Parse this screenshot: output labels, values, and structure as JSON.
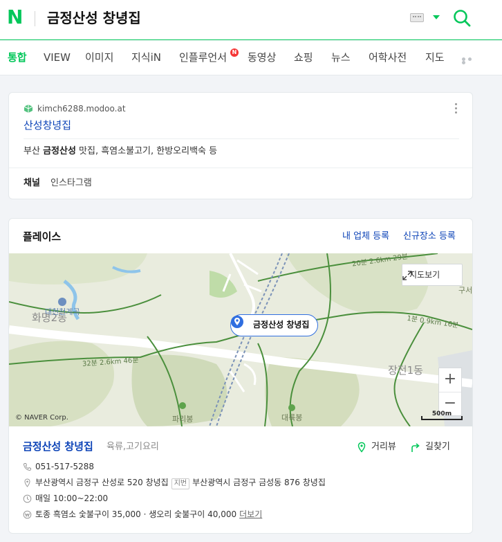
{
  "header": {
    "logo": "N",
    "query": "금정산성 창녕집"
  },
  "tabs": [
    {
      "label": "통합",
      "active": true
    },
    {
      "label": "VIEW"
    },
    {
      "label": "이미지"
    },
    {
      "label": "지식iN"
    },
    {
      "label": "인플루언서",
      "badge": "N"
    },
    {
      "label": "동영상"
    },
    {
      "label": "쇼핑"
    },
    {
      "label": "뉴스"
    },
    {
      "label": "어학사전"
    },
    {
      "label": "지도"
    }
  ],
  "site_result": {
    "url": "kimch6288.modoo.at",
    "title_prefix": "산성",
    "title_highlight": "창녕집",
    "desc_prefix": "부산 ",
    "desc_highlight": "금정산성",
    "desc_suffix": " 맛집, 흑염소불고기, 한방오리백숙 등",
    "channel_label": "채널",
    "channel_value": "인스타그램"
  },
  "place": {
    "section_title": "플레이스",
    "link_register": "내 업체 등록",
    "link_new": "신규장소 등록",
    "map": {
      "view_button": "지도보기",
      "pin_label": "금정산성 창녕집",
      "zoom_in": "+",
      "zoom_out": "−",
      "copyright": "© NAVER Corp.",
      "scale": "500m",
      "labels": {
        "hwamyeong": "화명2동",
        "daecheon": "대천천계곡",
        "jangjeon": "장전1동",
        "paribong": "파리봉",
        "daeryukbong": "대륙봉",
        "guseo": "구서",
        "road1": "32분 2.6km 46분",
        "road2": "20분 2.6km 29분",
        "road3": "1분 0.9km 16분"
      }
    },
    "name": "금정산성 창녕집",
    "category": "육류,고기요리",
    "action_distance": "거리뷰",
    "action_route": "길찾기",
    "phone": "051-517-5288",
    "address": "부산광역시 금정구 산성로 520 창녕집",
    "jibun_badge": "지번",
    "jibun_address": "부산광역시 금정구 금성동 876 창녕집",
    "hours": "매일 10:00~22:00",
    "menu": "토종 흑염소 숯불구이 35,000 · 생오리 숯불구이 40,000",
    "more": "더보기"
  },
  "colors": {
    "brand": "#03c75a",
    "link": "#0c43b7",
    "pin": "#2f6ee0"
  },
  "icons": [
    "naver-logo",
    "keyboard-icon",
    "search-icon",
    "site-icon",
    "kebab-icon",
    "expand-icon",
    "location-pin-icon",
    "street-view-icon",
    "route-icon",
    "phone-icon",
    "map-marker-icon",
    "clock-icon",
    "won-icon"
  ]
}
